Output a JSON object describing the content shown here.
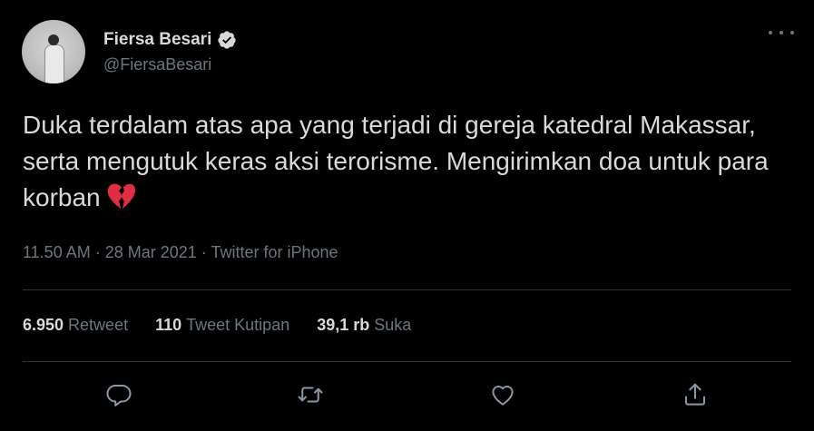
{
  "user": {
    "display_name": "Fiersa Besari",
    "handle": "@FiersaBesari",
    "verified": true,
    "avatar_icon": "avatar-photo"
  },
  "tweet": {
    "text": "Duka terdalam atas apa yang terjadi di gereja katedral Makassar, serta mengutuk keras aksi terorisme. Mengirimkan doa untuk para korban",
    "emoji": "broken-heart",
    "meta": "11.50 AM · 28 Mar 2021 · Twitter for iPhone"
  },
  "stats": {
    "retweets_count": "6.950",
    "retweets_label": "Retweet",
    "quotes_count": "110",
    "quotes_label": "Tweet Kutipan",
    "likes_count": "39,1 rb",
    "likes_label": "Suka"
  },
  "actions": {
    "reply_icon": "reply-icon",
    "retweet_icon": "retweet-icon",
    "like_icon": "heart-icon",
    "share_icon": "share-icon"
  },
  "colors": {
    "background": "#000000",
    "primary_text": "#d9d9d9",
    "secondary_text": "#6e767d",
    "divider": "#2f3336",
    "verified": "#d9d9d9",
    "emoji": "#dd2e44"
  }
}
